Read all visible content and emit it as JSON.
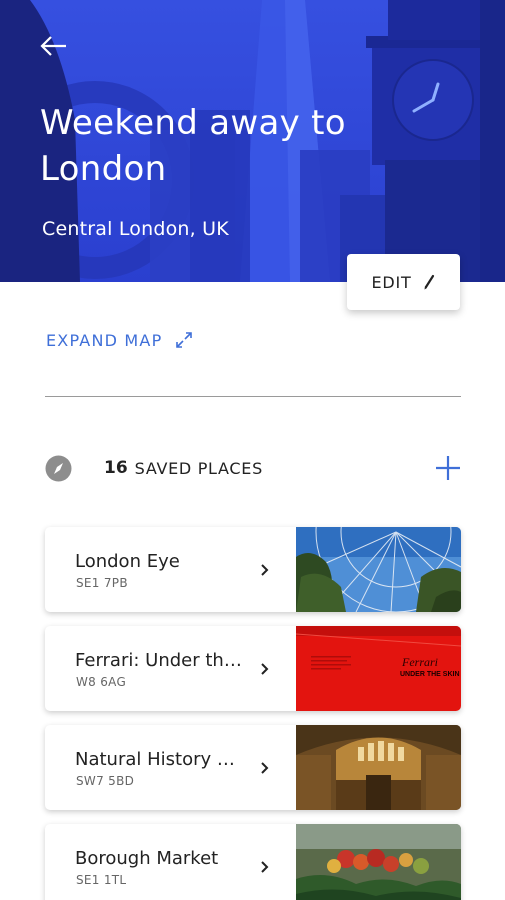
{
  "header": {
    "title": "Weekend away to London",
    "subtitle": "Central London, UK",
    "back_icon": "arrow-left-icon"
  },
  "edit_button": {
    "label": "EDIT",
    "icon": "pencil-icon"
  },
  "expand_map": {
    "label": "EXPAND MAP",
    "icon": "expand-arrows-icon"
  },
  "saved": {
    "count": "16",
    "label": "SAVED PLACES",
    "icon": "compass-icon",
    "add_icon": "plus-icon"
  },
  "places": [
    {
      "name": "London Eye",
      "postcode": "SE1 7PB"
    },
    {
      "name": "Ferrari: Under the…",
      "postcode": "W8 6AG",
      "image_text_line1": "Ferrari",
      "image_text_line2": "UNDER THE SKIN"
    },
    {
      "name": "Natural History M…",
      "postcode": "SW7 5BD"
    },
    {
      "name": "Borough Market",
      "postcode": "SE1 1TL"
    }
  ],
  "colors": {
    "hero": "#2f45d6",
    "accent": "#3f6fd8",
    "ferrari_red": "#e3140f"
  }
}
